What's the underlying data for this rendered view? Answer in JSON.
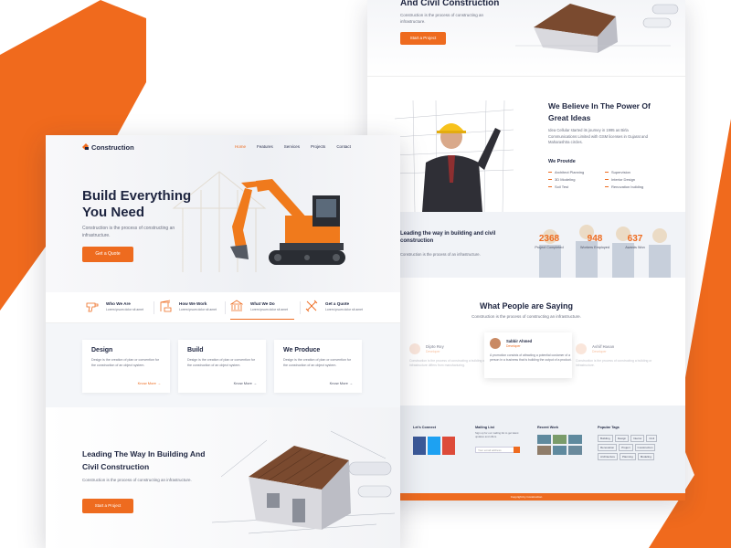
{
  "colors": {
    "accent": "#ee6b1f",
    "navy": "#1e2540",
    "muted": "#6b7080"
  },
  "top_section": {
    "title": "And Civil Construction",
    "subtitle": "Construction is the process of constructing an infrastructure.",
    "button": "Start a Project"
  },
  "believe": {
    "title": "We Believe In The Power Of Great Ideas",
    "text": "Idea Cellular started its journey in 1995 as Birla Communications Limited with GSM licenses in Gujarat and Maharashtra circles.",
    "provide_title": "We Provide",
    "provide": [
      "Architect Planning",
      "Supervision",
      "3D Modeling",
      "Interior Design",
      "Soil Test",
      "Renovation building"
    ]
  },
  "stats": {
    "title": "Leading the way in building and civil construction",
    "subtitle": "Construction is the process of an infrastructure.",
    "items": [
      {
        "num": "2368",
        "label": "Project Completed"
      },
      {
        "num": "948",
        "label": "Workers Employed"
      },
      {
        "num": "637",
        "label": "Awards Won"
      }
    ]
  },
  "testimonials": {
    "title": "What People are Saying",
    "subtitle": "Construction is the process of constructing an infrastructure.",
    "items": [
      {
        "name": "Dipto Roy",
        "role": "Developer",
        "text": "Construction is the process of constructing a building or infrastructure differs from manufacturing."
      },
      {
        "name": "Sabbir Ahmed",
        "role": "Developer",
        "text": "A promotion consists of attracting a potential customer of a person in a business that is building the output of a product."
      },
      {
        "name": "Ashif Hasan",
        "role": "Developer",
        "text": "Construction is the process of constructing a building or infrastructure."
      }
    ]
  },
  "footer": {
    "col1": "Let's Connect",
    "col2": "Mailing List",
    "col2_text": "Sign up for our mailing list to get latest updates and offers.",
    "input_placeholder": "Your email address",
    "col3": "Recent Work",
    "col4": "Popular Tags",
    "tags": [
      "Building",
      "Design",
      "Interior",
      "Civil",
      "Renovation",
      "Project",
      "Construction",
      "Architecture",
      "Planning",
      "Modeling"
    ],
    "copyright": "Copyright by Construction"
  },
  "nav": {
    "logo": "Construction",
    "items": [
      "Home",
      "Features",
      "Services",
      "Projects",
      "Contact"
    ]
  },
  "hero": {
    "title": "Build Everything You Need",
    "subtitle": "Construction is the process of constructing an infrastructure.",
    "button": "Get a Quote"
  },
  "tabs": [
    {
      "name": "Who We Are",
      "desc": "Lorem ipsum dolor sit amet"
    },
    {
      "name": "How We Work",
      "desc": "Lorem ipsum dolor sit amet"
    },
    {
      "name": "What We Do",
      "desc": "Lorem ipsum dolor sit amet"
    },
    {
      "name": "Get a Quote",
      "desc": "Lorem ipsum dolor sit amet"
    }
  ],
  "cards": [
    {
      "title": "Design",
      "text": "Design is the creation of plan or convention for the construction of an object system.",
      "more": "Know More"
    },
    {
      "title": "Build",
      "text": "Design is the creation of plan or convention for the construction of an object system.",
      "more": "Know More"
    },
    {
      "title": "We Produce",
      "text": "Design is the creation of plan or convention for the construction of an object system.",
      "more": "Know More"
    }
  ],
  "lead": {
    "title": "Leading The Way In Building And Civil Construction",
    "subtitle": "Construction is the process of constructing an infrastructure.",
    "button": "Start a Project"
  }
}
